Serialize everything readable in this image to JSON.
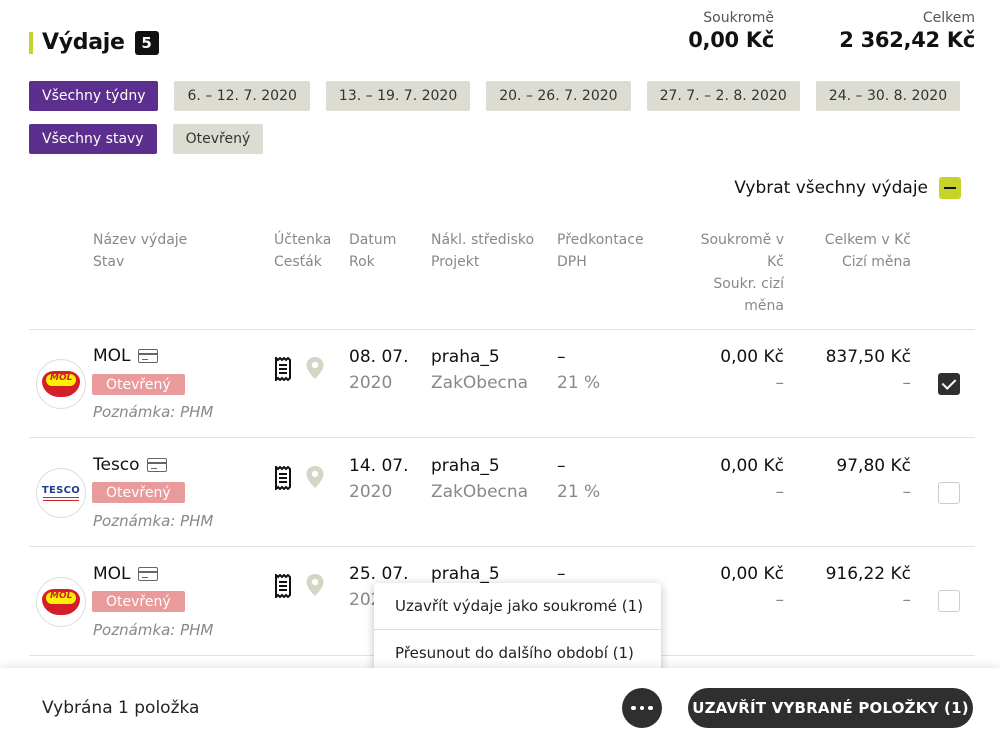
{
  "header": {
    "title": "Výdaje",
    "count": "5",
    "private_label": "Soukromě",
    "private_value": "0,00 Kč",
    "total_label": "Celkem",
    "total_value": "2 362,42 Kč"
  },
  "filters": {
    "weeks": [
      "Všechny týdny",
      "6. – 12. 7. 2020",
      "13. – 19. 7. 2020",
      "20. – 26. 7. 2020",
      "27. 7. – 2. 8. 2020",
      "24. – 30. 8. 2020"
    ],
    "states": [
      "Všechny stavy",
      "Otevřený"
    ]
  },
  "select_all_label": "Vybrat všechny výdaje",
  "columns": {
    "name": [
      "Název výdaje",
      "Stav"
    ],
    "receipt": [
      "Účtenka",
      "Cesťák"
    ],
    "date": [
      "Datum",
      "Rok"
    ],
    "cost_center": [
      "Nákl. středisko",
      "Projekt"
    ],
    "accounting": [
      "Předkontace",
      "DPH"
    ],
    "private": [
      "Soukromě v",
      "Kč",
      "Soukr. cizí",
      "měna"
    ],
    "total": [
      "Celkem v Kč",
      "Cizí měna"
    ]
  },
  "rows": [
    {
      "merchant": "MOL",
      "logo": "mol-logo",
      "status": "Otevřený",
      "note": "Poznámka: PHM",
      "date": "08. 07.",
      "year": "2020",
      "cost_center": "praha_5",
      "project": "ZakObecna",
      "accounting": "–",
      "vat": "21 %",
      "private": "0,00 Kč",
      "private_foreign": "–",
      "total": "837,50 Kč",
      "total_foreign": "–",
      "checked": true
    },
    {
      "merchant": "Tesco",
      "logo": "tesco-logo",
      "logo_text": "TESCO",
      "status": "Otevřený",
      "note": "Poznámka: PHM",
      "date": "14. 07.",
      "year": "2020",
      "cost_center": "praha_5",
      "project": "ZakObecna",
      "accounting": "–",
      "vat": "21 %",
      "private": "0,00 Kč",
      "private_foreign": "–",
      "total": "97,80 Kč",
      "total_foreign": "–",
      "checked": false
    },
    {
      "merchant": "MOL",
      "logo": "mol-logo",
      "status": "Otevřený",
      "note": "Poznámka: PHM",
      "date": "25. 07.",
      "year": "202",
      "cost_center": "praha_5",
      "project": "",
      "accounting": "–",
      "vat": "",
      "private": "0,00 Kč",
      "private_foreign": "–",
      "total": "916,22 Kč",
      "total_foreign": "–",
      "checked": false
    }
  ],
  "logo_text_mol": "MOL",
  "context_menu": {
    "items": [
      "Uzavřít výdaje jako soukromé (1)",
      "Přesunout do dalšího období (1)"
    ]
  },
  "footer": {
    "selected_label": "Vybrána 1 položka",
    "close_button": "UZAVŘÍT VYBRANÉ POLOŽKY (1)"
  },
  "colors": {
    "accent": "#c5d32a",
    "active_chip": "#5c2f8e",
    "status_open": "#e99a9a"
  }
}
